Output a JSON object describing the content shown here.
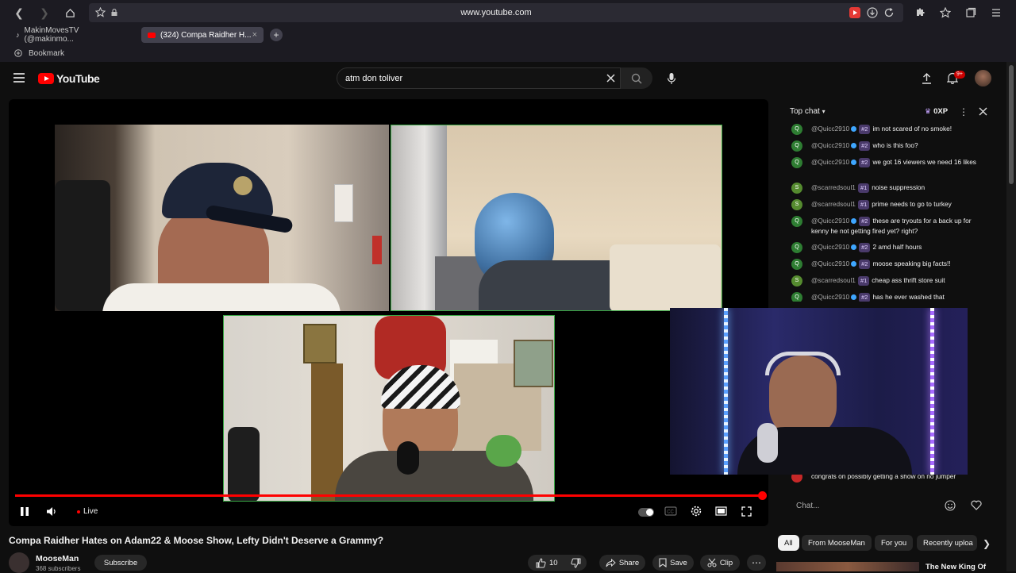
{
  "browser": {
    "url": "www.youtube.com",
    "tabs": [
      {
        "label": "MakinMovesTV (@makinmo..."
      },
      {
        "label": "(324) Compa Raidher H..."
      }
    ],
    "bookmark_label": "Bookmark"
  },
  "youtube": {
    "logo_text": "YouTube",
    "search_value": "atm don toliver",
    "notification_count": "9+"
  },
  "player": {
    "live_label": "Live",
    "progress_percent": 100
  },
  "chat": {
    "header_label": "Top chat",
    "xp_label": "0XP",
    "input_placeholder": "Chat...",
    "messages": [
      {
        "initial": "Q",
        "author": "@Quicc2910",
        "verified": true,
        "rank": "#2",
        "text": "im not scared of no smoke!",
        "color": "#2e7d32"
      },
      {
        "initial": "Q",
        "author": "@Quicc2910",
        "verified": true,
        "rank": "#2",
        "text": "who is this foo?",
        "color": "#2e7d32"
      },
      {
        "initial": "Q",
        "author": "@Quicc2910",
        "verified": true,
        "rank": "#2",
        "text": "we got 16 viewers we need 16 likes",
        "color": "#2e7d32"
      },
      {
        "initial": "S",
        "author": "@scarredsoul1",
        "verified": false,
        "rank": "#1",
        "text": "noise suppression",
        "color": "#558b2f"
      },
      {
        "initial": "S",
        "author": "@scarredsoul1",
        "verified": false,
        "rank": "#1",
        "text": "prime needs to go to turkey",
        "color": "#558b2f"
      },
      {
        "initial": "Q",
        "author": "@Quicc2910",
        "verified": true,
        "rank": "#2",
        "text": "these are tryouts for a back up for kenny he not getting fired yet? right?",
        "color": "#2e7d32"
      },
      {
        "initial": "Q",
        "author": "@Quicc2910",
        "verified": true,
        "rank": "#2",
        "text": "2 amd half hours",
        "color": "#2e7d32"
      },
      {
        "initial": "Q",
        "author": "@Quicc2910",
        "verified": true,
        "rank": "#2",
        "text": "moose speaking big facts!!",
        "color": "#2e7d32"
      },
      {
        "initial": "S",
        "author": "@scarredsoul1",
        "verified": false,
        "rank": "#1",
        "text": "cheap ass thrift store suit",
        "color": "#558b2f"
      },
      {
        "initial": "Q",
        "author": "@Quicc2910",
        "verified": true,
        "rank": "#2",
        "text": "has he ever washed that",
        "color": "#2e7d32"
      }
    ],
    "last_message": "congrats on possibly getting a show on no jumper"
  },
  "video": {
    "title": "Compa Raidher Hates on Adam22 & Moose Show, Lefty Didn't Deserve a Grammy?",
    "channel_name": "MooseMan",
    "subscriber_count": "368 subscribers",
    "subscribe_label": "Subscribe",
    "likes": "10",
    "share_label": "Share",
    "save_label": "Save",
    "clip_label": "Clip"
  },
  "chips": [
    {
      "label": "All",
      "selected": true
    },
    {
      "label": "From MooseMan",
      "selected": false
    },
    {
      "label": "For you",
      "selected": false
    },
    {
      "label": "Recently uploa",
      "selected": false
    }
  ],
  "recommended_title": "The New King Of"
}
